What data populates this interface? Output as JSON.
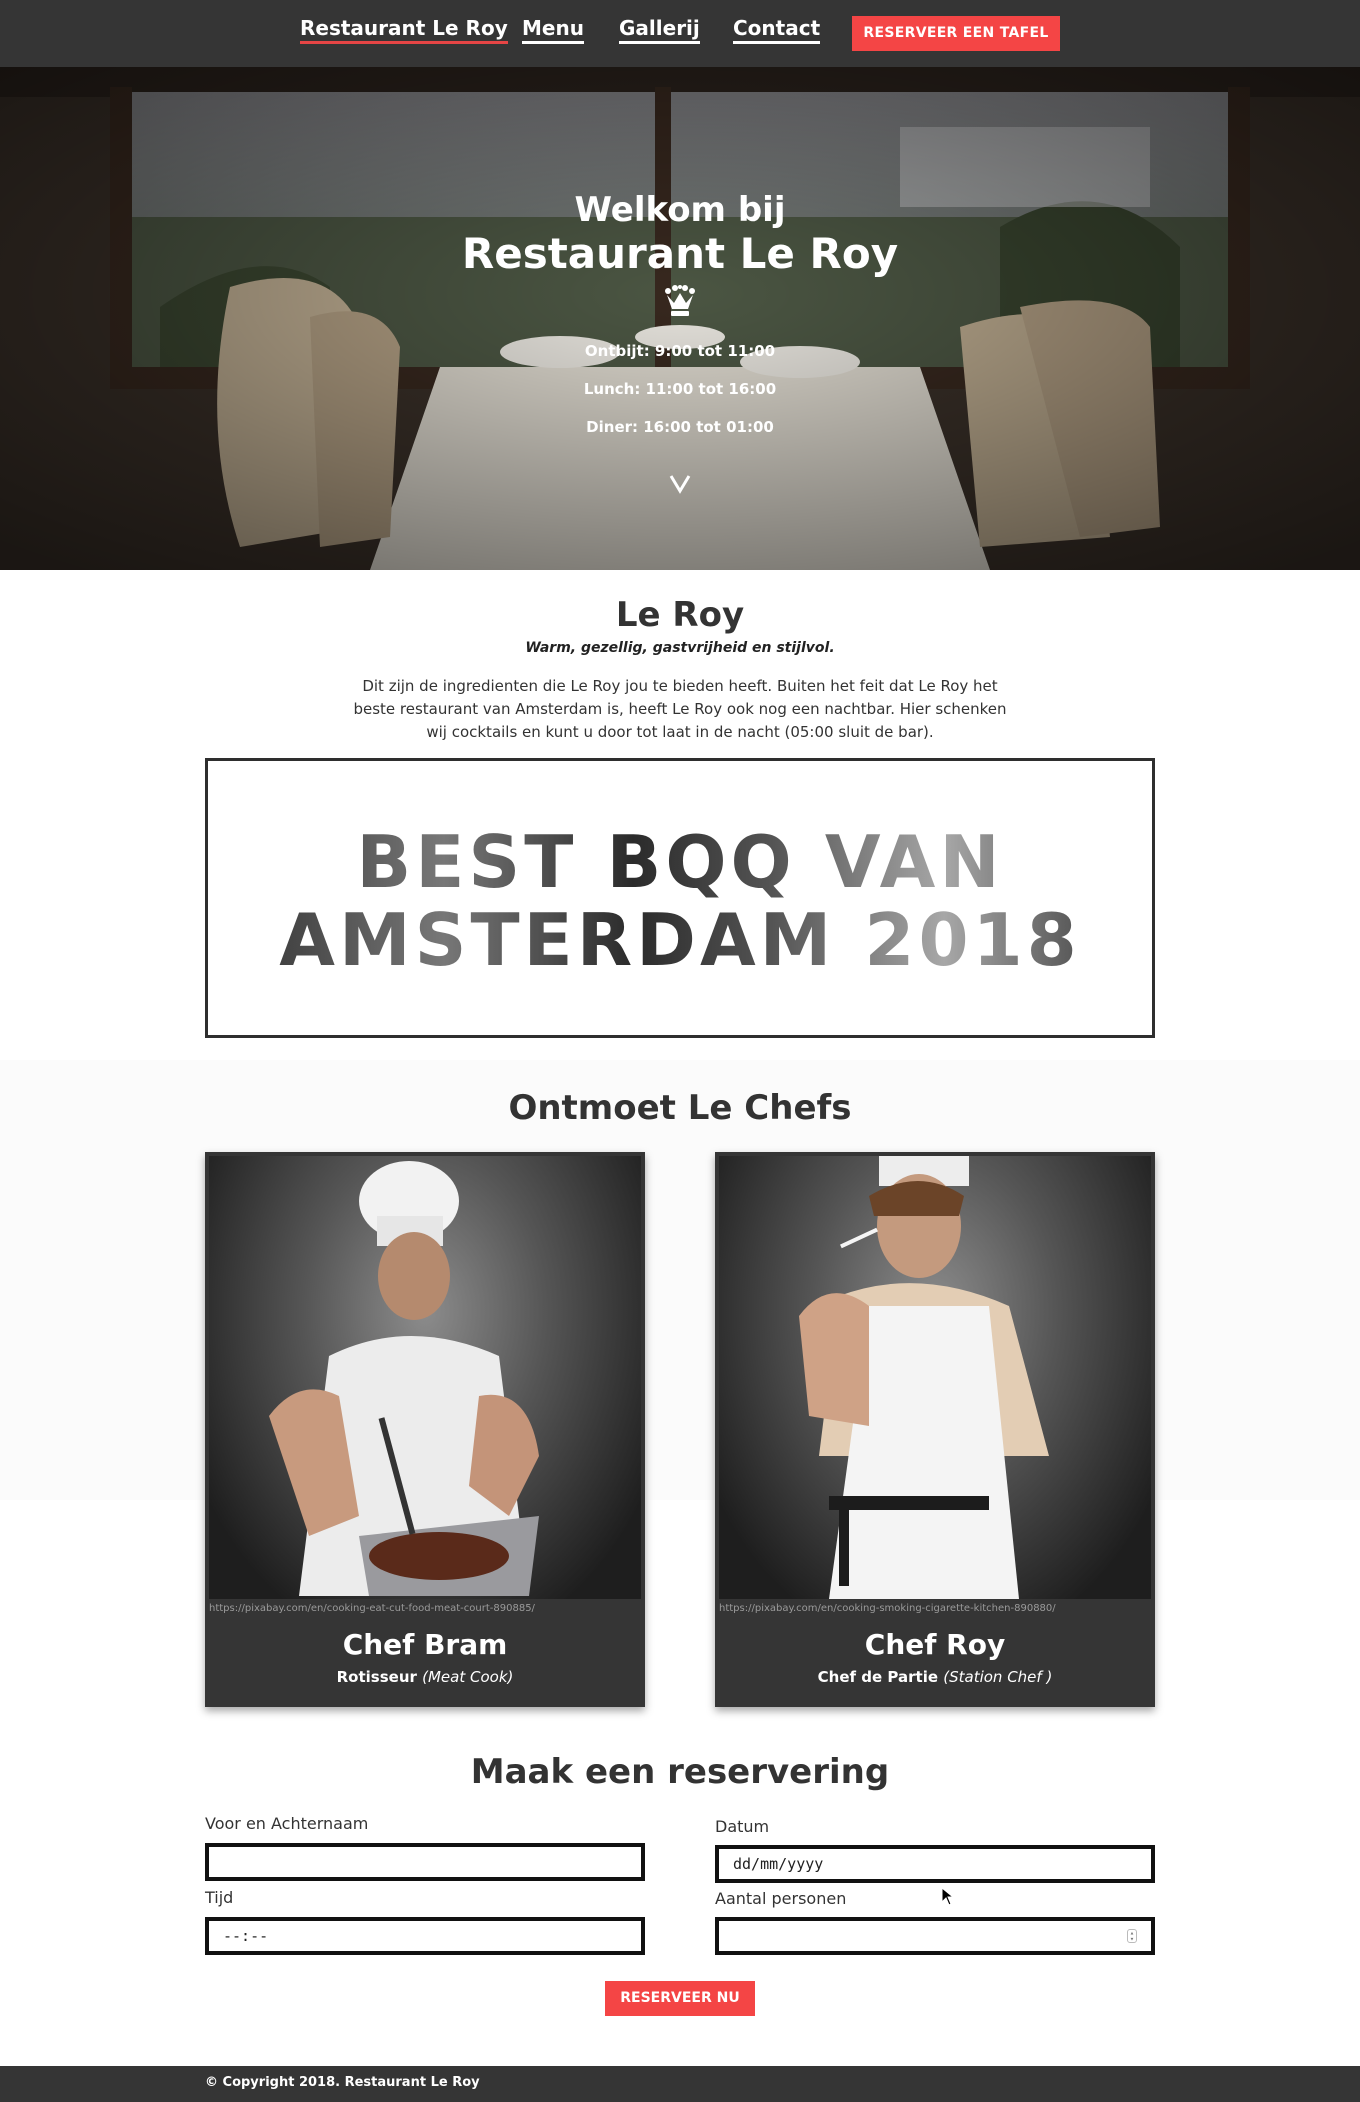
{
  "nav": {
    "brand": "Restaurant Le Roy",
    "menu": "Menu",
    "gallery": "Gallerij",
    "contact": "Contact",
    "cta": "RESERVEER EEN TAFEL"
  },
  "hero": {
    "welcome": "Welkom bij",
    "title": "Restaurant Le Roy",
    "icon": "crown-icon",
    "hours": [
      "Ontbijt: 9:00 tot 11:00",
      "Lunch: 11:00 tot 16:00",
      "Diner: 16:00 tot 01:00"
    ],
    "scroll_icon": "chevron-down-icon"
  },
  "intro": {
    "title": "Le Roy",
    "tagline": "Warm, gezellig, gastvrijheid en stijlvol.",
    "text": "Dit zijn de ingredienten die Le Roy jou te bieden heeft. Buiten het feit dat Le Roy het beste restaurant van Amsterdam is, heeft Le Roy ook nog een nachtbar. Hier schenken wij cocktails en kunt u door tot laat in de nacht (05:00 sluit de bar)."
  },
  "banner": {
    "line1": "BEST BQQ VAN",
    "line2": "AMSTERDAM 2018"
  },
  "chefs": {
    "title": "Ontmoet Le Chefs",
    "items": [
      {
        "credit": "https://pixabay.com/en/cooking-eat-cut-food-meat-court-890885/",
        "name": "Chef Bram",
        "role": "Rotisseur",
        "role_detail": "(Meat Cook)"
      },
      {
        "credit": "https://pixabay.com/en/cooking-smoking-cigarette-kitchen-890880/",
        "name": "Chef Roy",
        "role": "Chef de Partie",
        "role_detail": "(Station Chef )"
      }
    ]
  },
  "reservation": {
    "title": "Maak een reservering",
    "name_label": "Voor en Achternaam",
    "name_value": "",
    "date_label": "Datum",
    "date_value": "dd/mm/yyyy",
    "time_label": "Tijd",
    "time_value": "--:--",
    "persons_label": "Aantal personen",
    "persons_value": "",
    "submit": "RESERVEER NU"
  },
  "footer": {
    "copyright": "© Copyright 2018. Restaurant Le Roy"
  },
  "colors": {
    "accent": "#f44545",
    "dark": "#353535"
  }
}
